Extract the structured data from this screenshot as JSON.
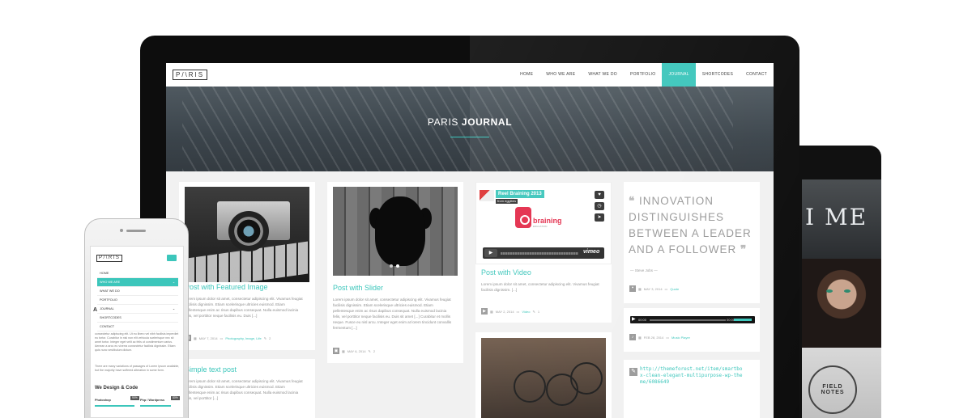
{
  "nav": {
    "logo": "P/\\RIS",
    "items": [
      "HOME",
      "WHO WE ARE",
      "WHAT WE DO",
      "PORTFOLIO",
      "JOURNAL",
      "SHORTCODES",
      "CONTACT"
    ],
    "active": "JOURNAL"
  },
  "hero": {
    "title_light": "PARIS ",
    "title_bold": "JOURNAL"
  },
  "posts": {
    "featured": {
      "title": "Post with Featured Image",
      "excerpt": "Lorem ipsum dolor sit amet, consectetur adipiscing elit. Vivamus feugiat facilisis dignissim. Etiam scelerisque ultricies euismod. Etiam pellentesque enim ac risus dapibus consequat. Nulla euismod lacinia felis, vel porttitor neque facilisis eu. Duis [...]",
      "date": "MAY 7, 2014",
      "categories": "Photography, Image, Life",
      "comments": "2"
    },
    "slider": {
      "title": "Post with Slider",
      "excerpt": "Lorem ipsum dolor sit amet, consectetur adipiscing elit. Vivamus feugiat facilisis dignissim. Etiam scelerisque ultricies euismod. Etiam pellentesque enim ac risus dapibus consequat. Nulla euismod lacinia felis, vel porttitor neque facilisis eu. Duis sit amet [...] Curabitur et mollis neque. Fusce eu nisl arcu. Integer eget enim at lorem tincidunt convallis fermentum [...]",
      "date": "MAY 6, 2014",
      "comments": "2"
    },
    "video": {
      "title": "Post with Video",
      "video_title": "Reel Braining 2013",
      "video_from": "from eggibes",
      "brand_name": "braining",
      "brand_sub": "EDUCATION",
      "player_brand": "vimeo",
      "excerpt": "Lorem ipsum dolor sit amet, consectetur adipiscing elit. Vivamus feugiat facilisis dignissim. [...]",
      "date": "MAY 2, 2014",
      "category": "Video",
      "comments": "1"
    },
    "text": {
      "title": "Simple text post",
      "excerpt": "Lorem ipsum dolor sit amet, consectetur adipiscing elit. Vivamus feugiat facilisis dignissim. Etiam scelerisque ultricies euismod. Etiam pellentesque enim ac risus dapibus consequat. Nulla euismod lacinia felis, vel porttitor [...]"
    },
    "quote": {
      "text": "INNOVATION DISTINGUISHES BETWEEN A LEADER AND A FOLLOWER",
      "author": "— Steve Jobs —",
      "date": "MAY 3, 2014",
      "category": "Quote"
    },
    "audio": {
      "time_start": "00:00",
      "time_end": "00:00",
      "date": "FEB 28, 2014",
      "category": "Music Player"
    },
    "link": {
      "url": "http://themeforest.net/item/smartbox-clean-elegant-multipurpose-wp-theme/6086649"
    }
  },
  "tablet": {
    "big_letters": "I ME",
    "badge": "FIELD NOTES"
  },
  "phone": {
    "logo": "P/\\RIS",
    "menu": [
      "HOME",
      "WHO WE ARE",
      "WHAT WE DO",
      "PORTFOLIO",
      "JOURNAL",
      "SHORTCODES",
      "CONTACT"
    ],
    "active": "WHO WE ARE",
    "side_letter": "A",
    "paragraph1": "consectetur adipiscing elit. Ut eu libero vel nibh facilisis imperdiet eu tortor. Curabitur in nisl non elit vehicula scelerisque nec sit amet tortor. Integer eget velit ac felis ut condimentum varius. Aenean a arcu eu viverra consectetur facilisis dignissim. Etiam quis nunc vestibulum dictum.",
    "paragraph2": "There are many variations of passages of Lorem Ipsum available, but the majority have suffered alteration in some form.",
    "heading": "We Design & Code",
    "skills": [
      {
        "name": "Photoshop",
        "pct": "90%",
        "level": 90
      },
      {
        "name": "Php / Wordpress",
        "pct": "80%",
        "level": 80
      }
    ]
  },
  "colors": {
    "accent": "#3cc6bb",
    "hero": "#3b444b"
  },
  "icons": [
    "heart-icon",
    "clock-icon",
    "send-icon",
    "play-icon",
    "calendar-icon",
    "folder-icon",
    "comment-icon",
    "link-icon",
    "quote-icon",
    "menu-icon"
  ]
}
